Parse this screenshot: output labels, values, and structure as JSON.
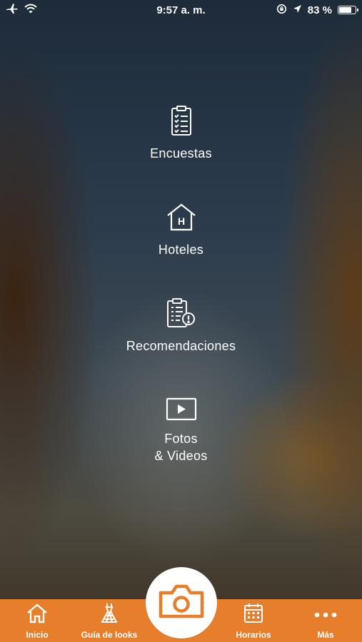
{
  "status_bar": {
    "time": "9:57 a. m.",
    "battery_percent_label": "83 %",
    "battery_level": 0.83,
    "icons": [
      "airplane-icon",
      "wifi-icon",
      "orientation-lock-icon",
      "location-arrow-icon",
      "battery-icon"
    ]
  },
  "menu": {
    "items": [
      {
        "label": "Encuestas",
        "icon": "clipboard-checklist-icon"
      },
      {
        "label": "Hoteles",
        "icon": "hotel-house-icon"
      },
      {
        "label": "Recomendaciones",
        "icon": "clipboard-alert-icon"
      },
      {
        "label_lines": [
          "Fotos",
          "& Videos"
        ],
        "icon": "video-play-icon"
      }
    ]
  },
  "tab_bar": {
    "accent_color": "#e67e2b",
    "tabs": [
      {
        "label": "Inicio",
        "icon": "home-icon"
      },
      {
        "label": "Guía de looks",
        "icon": "dress-icon"
      },
      {
        "label": "Horarios",
        "icon": "calendar-icon"
      },
      {
        "label": "Más",
        "icon": "more-dots-icon"
      }
    ],
    "center_button_icon": "camera-icon"
  }
}
